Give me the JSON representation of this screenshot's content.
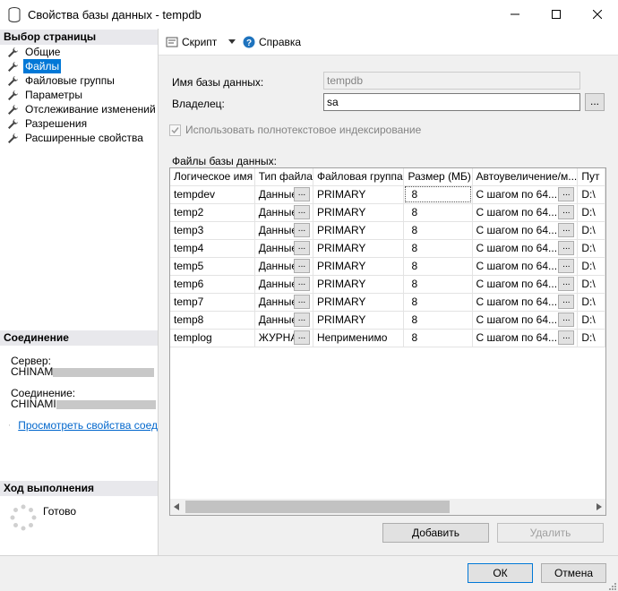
{
  "window": {
    "title": "Свойства базы данных - tempdb"
  },
  "left_panel": {
    "select_page_header": "Выбор страницы",
    "nav_items": [
      {
        "label": "Общие",
        "selected": false
      },
      {
        "label": "Файлы",
        "selected": true
      },
      {
        "label": "Файловые группы",
        "selected": false
      },
      {
        "label": "Параметры",
        "selected": false
      },
      {
        "label": "Отслеживание изменений",
        "selected": false
      },
      {
        "label": "Разрешения",
        "selected": false
      },
      {
        "label": "Расширенные свойства",
        "selected": false
      }
    ],
    "connection_header": "Соединение",
    "server_label": "Сервер:",
    "server_value": "CHINAM",
    "connection_label": "Соединение:",
    "connection_value": "CHINAMI",
    "view_props_link": "Просмотреть свойства соед",
    "progress_header": "Ход выполнения",
    "progress_status": "Готово"
  },
  "toolbar": {
    "script_label": "Скрипт",
    "help_label": "Справка"
  },
  "form": {
    "db_name_label": "Имя базы данных:",
    "db_name_value": "tempdb",
    "owner_label": "Владелец:",
    "owner_value": "sa",
    "fulltext_label": "Использовать полнотекстовое индексирование",
    "fulltext_checked": true,
    "files_label": "Файлы базы данных:"
  },
  "files_grid": {
    "columns": [
      "Логическое имя",
      "Тип файла",
      "Файловая группа",
      "Размер (МБ)",
      "Автоувеличение/м...",
      "Пут"
    ],
    "rows": [
      {
        "name": "tempdev",
        "type": "Данные...",
        "group": "PRIMARY",
        "size": "8",
        "auto": "С шагом по 64...",
        "path": "D:\\"
      },
      {
        "name": "temp2",
        "type": "Данные...",
        "group": "PRIMARY",
        "size": "8",
        "auto": "С шагом по 64...",
        "path": "D:\\"
      },
      {
        "name": "temp3",
        "type": "Данные...",
        "group": "PRIMARY",
        "size": "8",
        "auto": "С шагом по 64...",
        "path": "D:\\"
      },
      {
        "name": "temp4",
        "type": "Данные...",
        "group": "PRIMARY",
        "size": "8",
        "auto": "С шагом по 64...",
        "path": "D:\\"
      },
      {
        "name": "temp5",
        "type": "Данные...",
        "group": "PRIMARY",
        "size": "8",
        "auto": "С шагом по 64...",
        "path": "D:\\"
      },
      {
        "name": "temp6",
        "type": "Данные...",
        "group": "PRIMARY",
        "size": "8",
        "auto": "С шагом по 64...",
        "path": "D:\\"
      },
      {
        "name": "temp7",
        "type": "Данные...",
        "group": "PRIMARY",
        "size": "8",
        "auto": "С шагом по 64...",
        "path": "D:\\"
      },
      {
        "name": "temp8",
        "type": "Данные...",
        "group": "PRIMARY",
        "size": "8",
        "auto": "С шагом по 64...",
        "path": "D:\\"
      },
      {
        "name": "templog",
        "type": "ЖУРНАЛ",
        "group": "Неприменимо",
        "size": "8",
        "auto": "С шагом по 64...",
        "path": "D:\\"
      }
    ],
    "ellipsis": "..."
  },
  "buttons": {
    "add": "Добавить",
    "remove": "Удалить",
    "ok": "ОК",
    "cancel": "Отмена",
    "browse": "..."
  },
  "colors": {
    "selection": "#0078d7",
    "link": "#0066cc",
    "section_header": "#e8e8ec"
  }
}
